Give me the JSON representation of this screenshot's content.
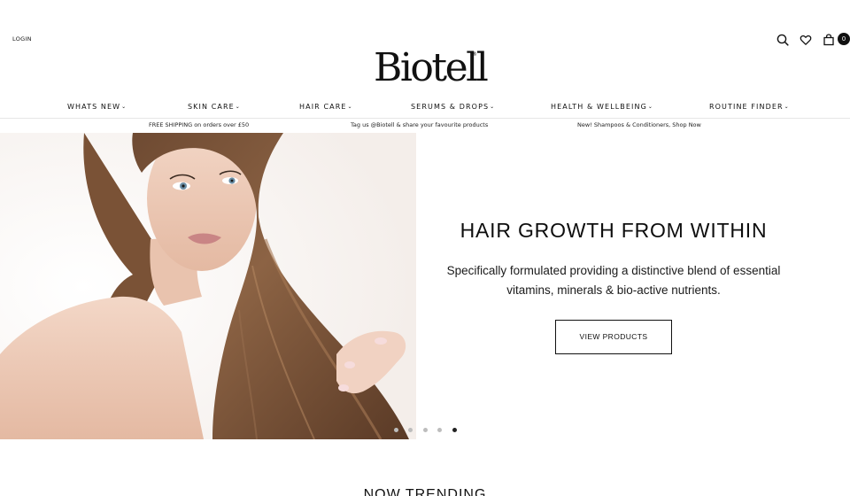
{
  "header": {
    "login_label": "LOGIN",
    "logo_text": "Biotell",
    "logo_mark": "®",
    "icons": [
      "search-icon",
      "heart-icon",
      "bag-icon"
    ],
    "cart_count": "0"
  },
  "nav": {
    "items": [
      {
        "label": "WHATS NEW"
      },
      {
        "label": "SKIN CARE"
      },
      {
        "label": "HAIR CARE"
      },
      {
        "label": "SERUMS & DROPS"
      },
      {
        "label": "HEALTH & WELLBEING"
      },
      {
        "label": "ROUTINE FINDER"
      }
    ],
    "chevron": "⌄"
  },
  "announcements": [
    "FREE SHIPPING on orders over £50",
    "Tag us @Biotell & share your favourite products",
    "New! Shampoos & Conditioners, Shop Now"
  ],
  "hero": {
    "title": "HAIR GROWTH FROM WITHIN",
    "subtitle_line1": "Specifically formulated providing a distinctive blend of essential",
    "subtitle_line2": "vitamins, minerals & bio-active nutrients.",
    "button_label": "VIEW PRODUCTS",
    "slide_count": 5,
    "active_slide": 5
  },
  "section": {
    "title": "NOW TRENDING"
  },
  "colors": {
    "text": "#111111",
    "background": "#ffffff",
    "divider": "#e6e6e6",
    "dot_inactive": "#bdbdbd",
    "dot_active": "#222222"
  }
}
